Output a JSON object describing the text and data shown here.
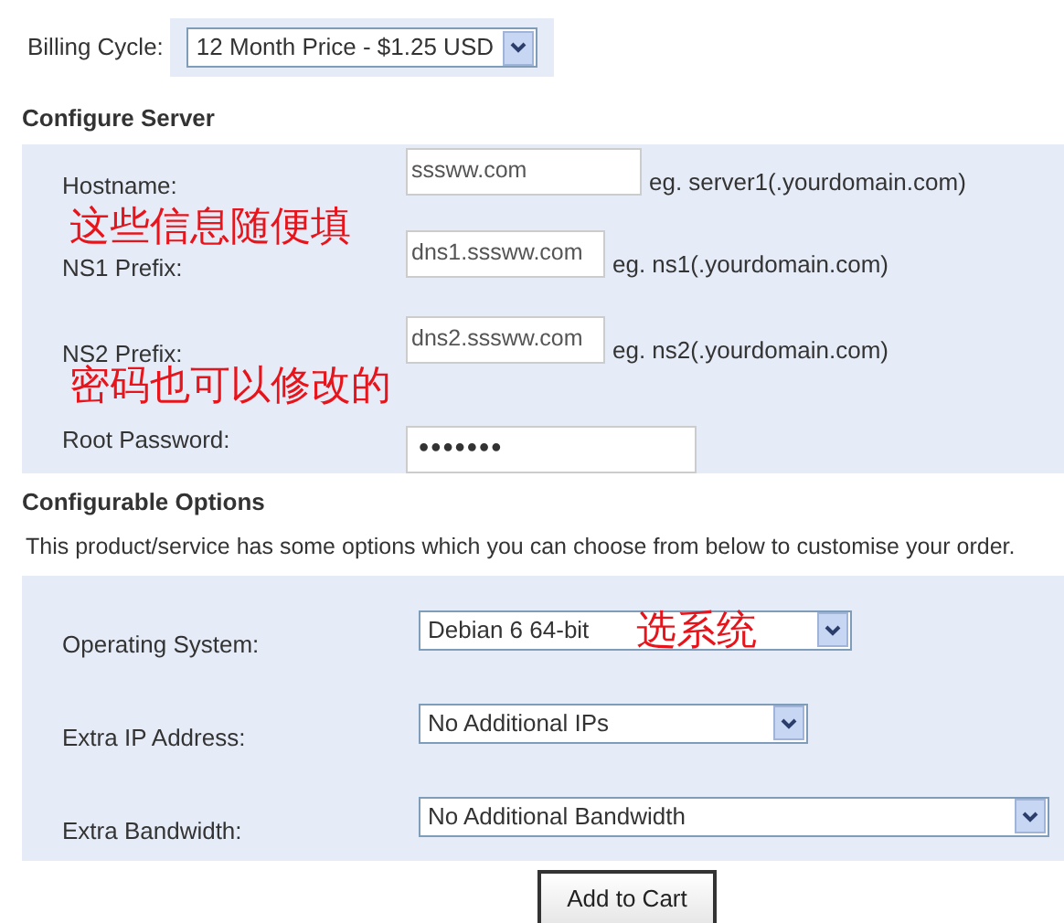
{
  "billing": {
    "label": "Billing Cycle:",
    "value": "12 Month Price - $1.25 USD"
  },
  "configure_server": {
    "heading": "Configure Server",
    "fields": [
      {
        "label": "Hostname:",
        "value": "sssww.com",
        "hint": "eg. server1(.yourdomain.com)",
        "kind": "text"
      },
      {
        "label": "NS1 Prefix:",
        "value": "dns1.sssww.com",
        "hint": "eg. ns1(.yourdomain.com)",
        "kind": "text"
      },
      {
        "label": "NS2 Prefix:",
        "value": "dns2.sssww.com",
        "hint": "eg. ns2(.yourdomain.com)",
        "kind": "text"
      },
      {
        "label": "Root Password:",
        "value": "•••••••",
        "kind": "password"
      }
    ]
  },
  "configurable_options": {
    "heading": "Configurable Options",
    "intro": "This product/service has some options which you can choose from below to customise your order.",
    "options": [
      {
        "label": "Operating System:",
        "value": "Debian 6 64-bit"
      },
      {
        "label": "Extra IP Address:",
        "value": "No Additional IPs"
      },
      {
        "label": "Extra Bandwidth:",
        "value": "No Additional Bandwidth"
      }
    ]
  },
  "annotations": [
    "这些信息随便填",
    "密码也可以修改的",
    "选系统"
  ],
  "button": "Add to Cart"
}
